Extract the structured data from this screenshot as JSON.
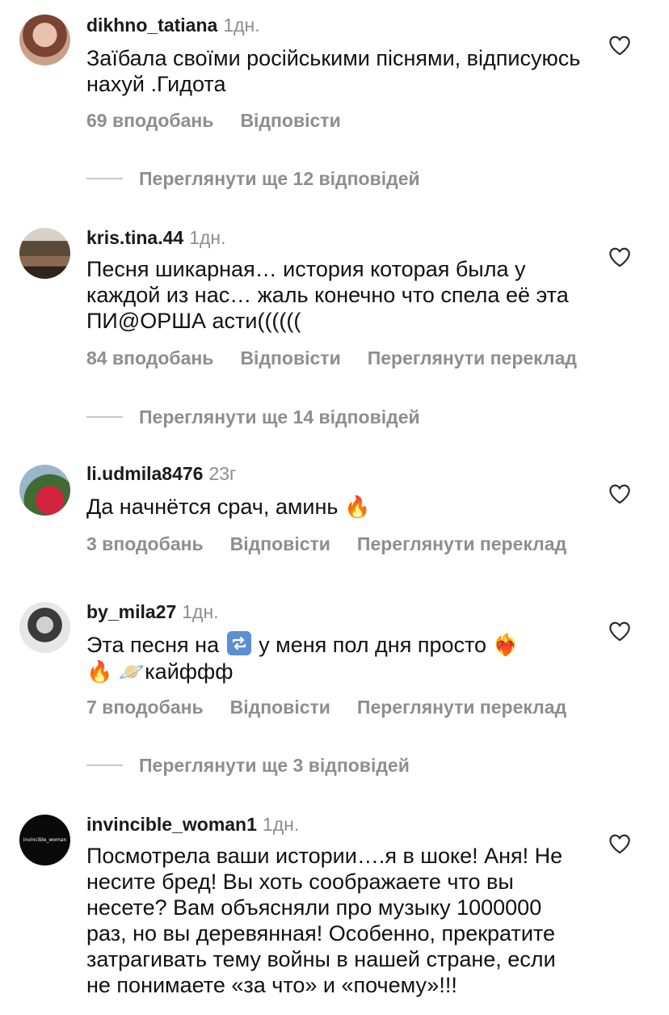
{
  "comments": [
    {
      "username": "dikhno_tatiana",
      "time": "1дн.",
      "text": "Заїбала своїми російськими піснями, відписуюсь нахуй .Гидота",
      "likes": "69 вподобань",
      "reply": "Відповісти",
      "view_replies": "Переглянути ще 12 відповідей"
    },
    {
      "username": "kris.tina.44",
      "time": "1дн.",
      "text": "Песня шикарная… история которая была у каждой из нас… жаль конечно что спела её эта ПИ@ОРША асти((((((",
      "likes": "84 вподобань",
      "reply": "Відповісти",
      "translate": "Переглянути переклад",
      "view_replies": "Переглянути ще 14 відповідей"
    },
    {
      "username": "li.udmila8476",
      "time": "23г",
      "text": "Да начнётся срач, аминь",
      "emoji": "🔥",
      "likes": "3 вподобань",
      "reply": "Відповісти",
      "translate": "Переглянути переклад"
    },
    {
      "username": "by_mila27",
      "time": "1дн.",
      "text_a": "Эта песня на",
      "text_b": "у меня пол дня просто",
      "emoji_heart": "❤️‍🔥",
      "emoji_fire": "🔥",
      "emoji_planet": "🪐",
      "text_c": "кайффф",
      "likes": "7 вподобань",
      "reply": "Відповісти",
      "translate": "Переглянути переклад",
      "view_replies": "Переглянути ще 3 відповідей"
    },
    {
      "username": "invincible_woman1",
      "time": "1дн.",
      "avatar_text": "invincible_woman",
      "text": "Посмотрела ваши истории….я в шоке! Аня! Не несите бред! Вы хоть соображаете что вы несете? Вам объясняли про музыку 1000000 раз, но вы деревянная! Особенно, прекратите затрагивать тему войны в нашей стране, если не понимаете «за что» и «почему»!!!"
    }
  ],
  "icons": {
    "like": "heart-outline-icon",
    "repeat": "repeat-emoji-icon"
  },
  "colors": {
    "muted": "#8e8e8e",
    "text": "#111111",
    "divider": "#c7c7c7"
  }
}
